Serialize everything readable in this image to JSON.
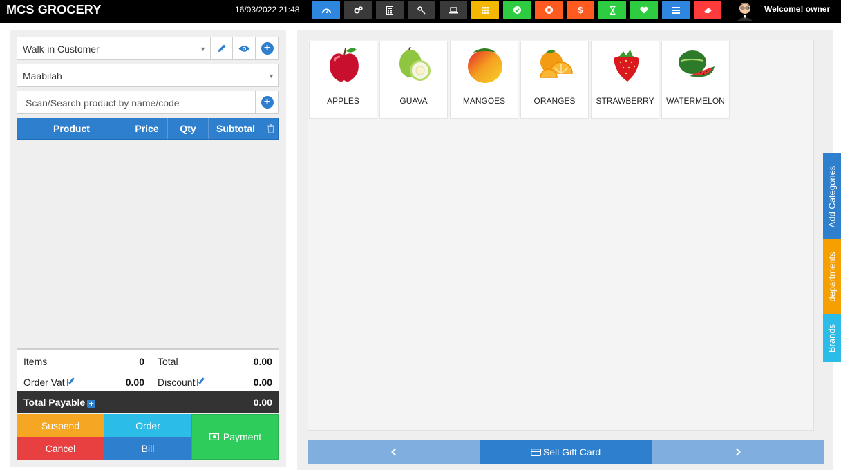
{
  "app": {
    "title": "MCS GROCERY",
    "datetime": "16/03/2022 21:48",
    "welcome": "Welcome! owner"
  },
  "toolbar": {
    "buttons": [
      {
        "name": "dashboard-icon",
        "color": "#2e86de"
      },
      {
        "name": "settings-icon",
        "color": "#3a3a3a"
      },
      {
        "name": "calculator-icon",
        "color": "#3a3a3a"
      },
      {
        "name": "shortcuts-key-icon",
        "color": "#3a3a3a"
      },
      {
        "name": "customer-display-icon",
        "color": "#3a3a3a"
      },
      {
        "name": "categories-grid-icon",
        "color": "#f5b800"
      },
      {
        "name": "register-check-icon",
        "color": "#2ecc40"
      },
      {
        "name": "close-register-icon",
        "color": "#ff5a1f"
      },
      {
        "name": "dollar-sales-icon",
        "color": "#ff5a1f"
      },
      {
        "name": "suspended-sales-hourglass-icon",
        "color": "#2ecc40"
      },
      {
        "name": "favorites-heart-icon",
        "color": "#2ecc40"
      },
      {
        "name": "list-sales-icon",
        "color": "#2e86de"
      },
      {
        "name": "clear-eraser-icon",
        "color": "#ff3b3b"
      }
    ]
  },
  "pos": {
    "customer": "Walk-in Customer",
    "warehouse": "Maabilah",
    "search_placeholder": "Scan/Search product by name/code",
    "columns": {
      "product": "Product",
      "price": "Price",
      "qty": "Qty",
      "subtotal": "Subtotal"
    },
    "totals": {
      "items_label": "Items",
      "items_value": "0",
      "total_label": "Total",
      "total_value": "0.00",
      "order_vat_label": "Order Vat",
      "order_vat_value": "0.00",
      "discount_label": "Discount",
      "discount_value": "0.00",
      "payable_label": "Total Payable",
      "payable_value": "0.00"
    },
    "actions": {
      "suspend": "Suspend",
      "order": "Order",
      "payment": "Payment",
      "cancel": "Cancel",
      "bill": "Bill"
    }
  },
  "products": [
    {
      "name": "APPLES"
    },
    {
      "name": "GUAVA"
    },
    {
      "name": "MANGOES"
    },
    {
      "name": "ORANGES"
    },
    {
      "name": "STRAWBERRY"
    },
    {
      "name": "WATERMELON"
    }
  ],
  "pager": {
    "gift_card": "Sell Gift Card"
  },
  "side_tabs": {
    "categories": "Add Categories",
    "departments": "departments",
    "brands": "Brands"
  },
  "colors": {
    "primary": "#2e7fcd",
    "suspend": "#f5a623",
    "order": "#2bbce8",
    "cancel": "#e84040",
    "payment": "#2ecc5a"
  }
}
